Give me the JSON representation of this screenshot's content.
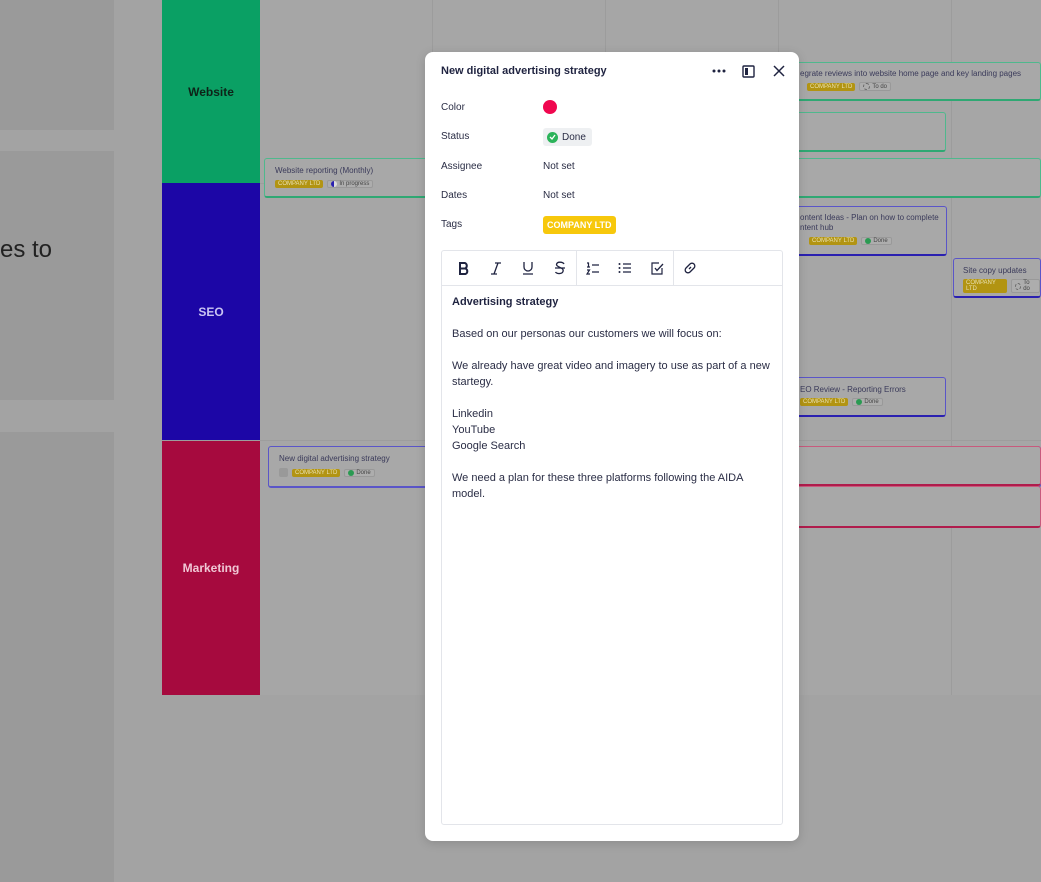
{
  "background": {
    "partial_text": "es to",
    "lanes": [
      {
        "label": "Website",
        "color": "#0aa064"
      },
      {
        "label": "SEO",
        "color": "#1c06a6"
      },
      {
        "label": "Marketing",
        "color": "#a60a3e"
      }
    ],
    "cards": {
      "integrate": {
        "title": "egrate reviews into website home page and key landing pages",
        "tag": "COMPANY LTD",
        "status": "To do"
      },
      "website_reporting": {
        "title": "Website reporting (Monthly)",
        "tag": "COMPANY LTD",
        "status": "In progress"
      },
      "content_ideas": {
        "title_line1": "ontent Ideas - Plan on how to complete",
        "title_line2": "ntent hub",
        "tag": "COMPANY LTD",
        "status": "Done"
      },
      "site_copy": {
        "title": "Site copy updates",
        "tag": "COMPANY LTD",
        "status": "To do"
      },
      "seo_review": {
        "title": "EO Review - Reporting Errors",
        "tag": "COMPANY LTD",
        "status": "Done"
      },
      "new_digital": {
        "title": "New digital advertising strategy",
        "tag": "COMPANY LTD",
        "status": "Done"
      }
    }
  },
  "modal": {
    "title": "New digital advertising strategy",
    "properties": {
      "color_label": "Color",
      "color_value": "#f0074f",
      "status_label": "Status",
      "status_value": "Done",
      "assignee_label": "Assignee",
      "assignee_value": "Not set",
      "dates_label": "Dates",
      "dates_value": "Not set",
      "tags_label": "Tags",
      "tag_value": "COMPANY LTD"
    },
    "toolbar_icons": [
      "bold-icon",
      "italic-icon",
      "underline-icon",
      "strikethrough-icon",
      "ordered-list-icon",
      "bullet-list-icon",
      "checklist-icon",
      "link-icon"
    ],
    "content": {
      "heading": "Advertising strategy",
      "p1": "Based on our personas our customers we will focus on:",
      "p2": "We already have great video and imagery to use as part of a new startegy.",
      "list": [
        "Linkedin",
        "YouTube",
        "Google Search"
      ],
      "p3": "We need a plan for these three platforms following the AIDA model."
    }
  }
}
